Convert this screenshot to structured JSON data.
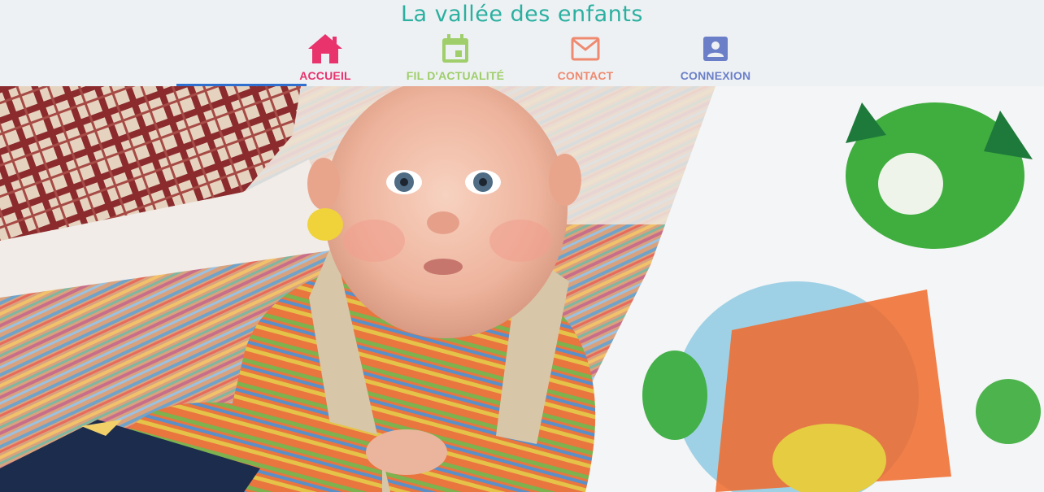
{
  "site": {
    "title": "La vallée des enfants"
  },
  "nav": {
    "items": [
      {
        "label": "ACCUEIL",
        "icon": "home-icon",
        "color": "#e8336d",
        "active": true
      },
      {
        "label": "FIL D'ACTUALITÉ",
        "icon": "calendar-icon",
        "color": "#9fce6a",
        "active": false
      },
      {
        "label": "CONTACT",
        "icon": "mail-icon",
        "color": "#ef8a70",
        "active": false
      },
      {
        "label": "CONNEXION",
        "icon": "account-icon",
        "color": "#6b7fc9",
        "active": false
      }
    ],
    "active_color": "#2f6fd0"
  },
  "colors": {
    "title": "#2bb0a0",
    "header_bg": "#eef1f4"
  }
}
